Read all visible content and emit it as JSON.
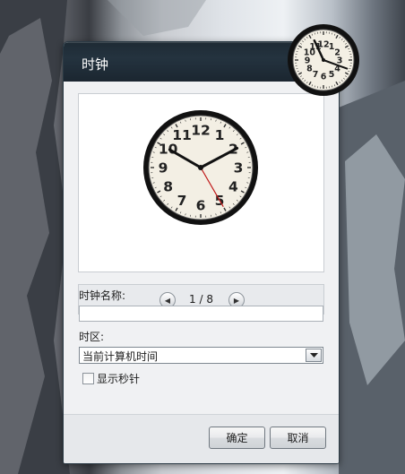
{
  "dialog": {
    "title": "时钟",
    "pager_text": "1 / 8",
    "clock_name_label": "时钟名称:",
    "clock_name_value": "",
    "timezone_label": "时区:",
    "timezone_value": "当前计算机时间",
    "seconds_label": "显示秒针",
    "seconds_checked": false,
    "ok_label": "确定",
    "cancel_label": "取消",
    "preview_clock": {
      "numbers": [
        "12",
        "1",
        "2",
        "3",
        "4",
        "5",
        "6",
        "7",
        "8",
        "9",
        "10",
        "11"
      ]
    }
  },
  "gadget_clock": {
    "numbers": [
      "12",
      "1",
      "2",
      "3",
      "4",
      "5",
      "6",
      "7",
      "8",
      "9",
      "10",
      "11"
    ]
  },
  "icons": {
    "prev": "chevron-left-icon",
    "next": "chevron-right-icon",
    "dropdown": "chevron-down-icon"
  }
}
